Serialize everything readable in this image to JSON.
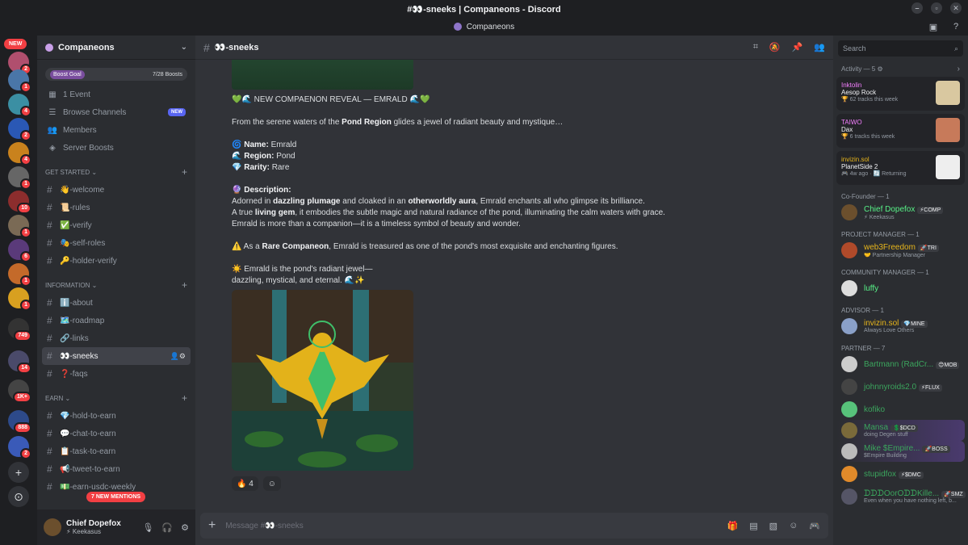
{
  "window": {
    "title": "#👀-sneeks | Companeons - Discord",
    "subtitle": "Companeons"
  },
  "rail": {
    "new_label": "NEW",
    "badges": [
      "2",
      "1",
      "4",
      "2",
      "4",
      "1",
      "10",
      "1",
      "6",
      "1",
      "1",
      "749",
      "14",
      "1K+",
      "888",
      "2"
    ]
  },
  "guild": {
    "name": "Companeons",
    "boost_label": "Boost Goal",
    "boost_count": "7/28 Boosts",
    "menu": [
      {
        "label": "1 Event",
        "icon": "calendar-icon"
      },
      {
        "label": "Browse Channels",
        "icon": "browse-icon",
        "tag": "NEW"
      },
      {
        "label": "Members",
        "icon": "members-icon"
      },
      {
        "label": "Server Boosts",
        "icon": "boost-icon"
      }
    ],
    "categories": [
      {
        "name": "GET STARTED",
        "channels": [
          "👋-welcome",
          "📜-rules",
          "✅-verify",
          "🎭-self-roles",
          "🔑-holder-verify"
        ]
      },
      {
        "name": "INFORMATION",
        "channels": [
          "ℹ️-about",
          "🗺️-roadmap",
          "🔗-links",
          "👀-sneeks",
          "❓-faqs"
        ]
      },
      {
        "name": "EARN",
        "channels": [
          "💎-hold-to-earn",
          "💬-chat-to-earn",
          "📋-task-to-earn",
          "📢-tweet-to-earn",
          "💵-earn-usdc-weekly"
        ]
      }
    ],
    "new_mentions": "7 NEW MENTIONS"
  },
  "user": {
    "name": "Chief Dopefox",
    "status": "⚡ Keekasus"
  },
  "channel": {
    "name": "👀-sneeks",
    "composer_placeholder": "Message #👀-sneeks"
  },
  "message": {
    "headline": "💚🌊 NEW COMPAENON REVEAL — EMRALD 🌊💚",
    "intro_pre": "From the serene waters of the ",
    "intro_bold": "Pond Region",
    "intro_post": " glides a jewel of radiant beauty and mystique…",
    "name_label": "Name:",
    "name_value": " Emrald",
    "region_label": "Region:",
    "region_value": " Pond",
    "rarity_label": "Rarity:",
    "rarity_value": " Rare",
    "desc_label": "Description:",
    "desc1_a": "Adorned in ",
    "desc1_b": "dazzling plumage",
    "desc1_c": " and cloaked in an ",
    "desc1_d": "otherworldly aura",
    "desc1_e": ", Emrald enchants all who glimpse its brilliance.",
    "desc2_a": "A true ",
    "desc2_b": "living gem",
    "desc2_c": ", it embodies the subtle magic and natural radiance of the pond, illuminating the calm waters with grace.",
    "desc3": "Emrald is more than a companion—it is a timeless symbol of beauty and wonder.",
    "rare_a": "⚠️ As a ",
    "rare_b": "Rare Companeon",
    "rare_c": ", Emrald is treasured as one of the pond's most exquisite and enchanting figures.",
    "outro1": "☀️ Emrald is the pond's radiant jewel—",
    "outro2": "dazzling, mystical, and eternal. 🌊✨",
    "reaction_emoji": "🔥",
    "reaction_count": "4"
  },
  "members": {
    "search_placeholder": "Search",
    "activity_header": "Activity — 5",
    "activities": [
      {
        "user": "Inktolin",
        "title": "Aesop Rock",
        "detail": "🏆 62 tracks this week",
        "color": "#f47fff"
      },
      {
        "user": "TAIWO",
        "title": "Dax",
        "detail": "🏆 6 tracks this week",
        "color": "#f47fff"
      },
      {
        "user": "invizin.sol",
        "title": "PlanetSide 2",
        "detail": "🎮 4w ago · 🔄 Returning",
        "color": "#e7b51b"
      }
    ],
    "groups": [
      {
        "name": "Co-Founder — 1",
        "list": [
          {
            "name": "Chief Dopefox",
            "tag": "⚡COMP",
            "sub": "⚡ Keekasus",
            "color": "#57f287"
          }
        ]
      },
      {
        "name": "PROJECT MANAGER — 1",
        "list": [
          {
            "name": "web3Freedom",
            "tag": "🚀TRI",
            "sub": "🤝 Partnership Manager",
            "color": "#e7b51b"
          }
        ]
      },
      {
        "name": "COMMUNITY MANAGER — 1",
        "list": [
          {
            "name": "luffy",
            "tag": "",
            "sub": "",
            "color": "#57f287"
          }
        ]
      },
      {
        "name": "ADVISOR — 1",
        "list": [
          {
            "name": "invizin.sol",
            "tag": "💎MINE",
            "sub": "Always Love Others",
            "color": "#e7b51b"
          }
        ]
      },
      {
        "name": "PARTNER — 7",
        "list": [
          {
            "name": "Bartmann (RadCr...",
            "tag": "😊MOB",
            "sub": "",
            "color": "#3ba55d"
          },
          {
            "name": "johnnyroids2.0",
            "tag": "⚡FLUX",
            "sub": "",
            "color": "#3ba55d"
          },
          {
            "name": "kofiko",
            "tag": "",
            "sub": "",
            "color": "#3ba55d"
          },
          {
            "name": "Mansa",
            "tag": "💲$DCD",
            "sub": "doing Degen stuff",
            "color": "#3ba55d"
          },
          {
            "name": "Mike $Empire...",
            "tag": "🚀BOSS",
            "sub": "$Empire Building",
            "color": "#3ba55d"
          },
          {
            "name": "stupidfox",
            "tag": "⚡$DMC",
            "sub": "",
            "color": "#3ba55d"
          },
          {
            "name": "ᗪᗪᗪOorOᗪᗪKille...",
            "tag": "🚀SMZ",
            "sub": "Even when you have nothing left, b...",
            "color": "#3ba55d"
          }
        ]
      }
    ]
  }
}
